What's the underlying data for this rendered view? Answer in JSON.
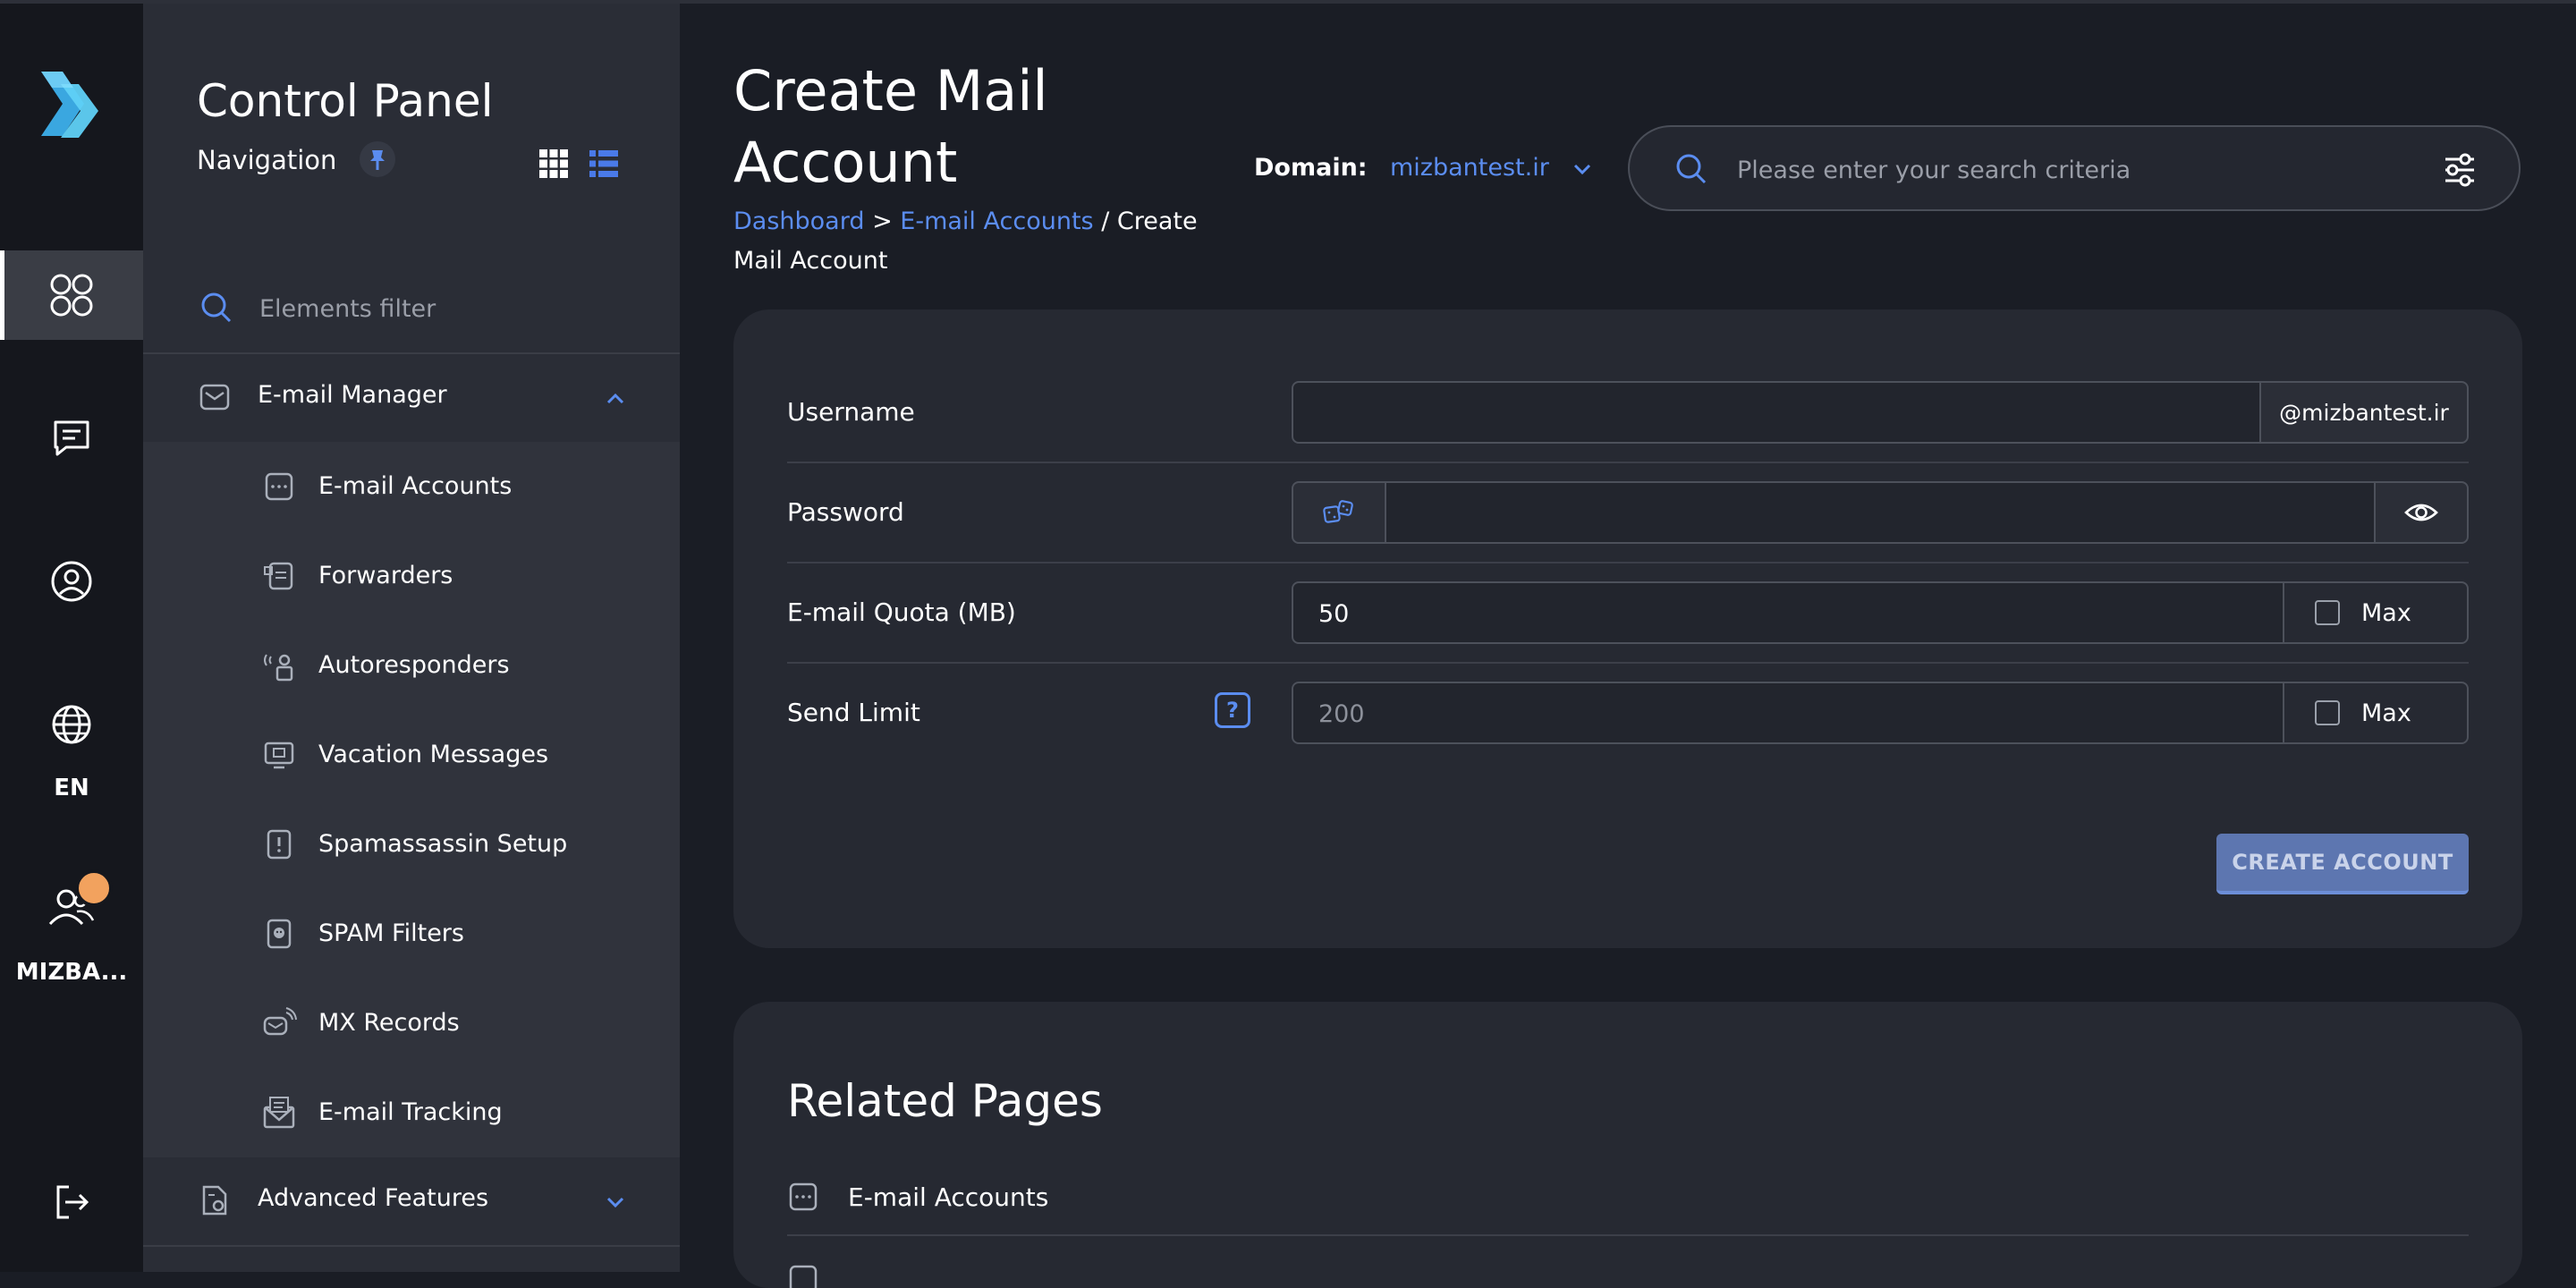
{
  "nav": {
    "title": "Control Panel",
    "subtitle": "Navigation",
    "filter_placeholder": "Elements filter",
    "groups": [
      {
        "label": "E-mail Manager",
        "expanded": true
      },
      {
        "label": "Advanced Features",
        "expanded": false
      }
    ],
    "items": [
      {
        "label": "E-mail Accounts",
        "icon": "email-accounts-icon"
      },
      {
        "label": "Forwarders",
        "icon": "forwarders-icon"
      },
      {
        "label": "Autoresponders",
        "icon": "autoresponders-icon"
      },
      {
        "label": "Vacation Messages",
        "icon": "vacation-messages-icon"
      },
      {
        "label": "Spamassassin Setup",
        "icon": "spamassassin-icon"
      },
      {
        "label": "SPAM Filters",
        "icon": "spam-filters-icon"
      },
      {
        "label": "MX Records",
        "icon": "mx-records-icon"
      },
      {
        "label": "E-mail Tracking",
        "icon": "email-tracking-icon"
      }
    ]
  },
  "rail": {
    "language": "EN",
    "user": "MIZBA..."
  },
  "header": {
    "title_line1": "Create Mail",
    "title_line2": "Account",
    "breadcrumb": {
      "dashboard": "Dashboard",
      "sep1": " > ",
      "email_accounts": "E-mail Accounts",
      "sep2": " / ",
      "current": "Create Mail Account"
    },
    "domain_label": "Domain:",
    "domain_value": "mizbantest.ir",
    "search_placeholder": "Please enter your search criteria"
  },
  "form": {
    "username_label": "Username",
    "username_value": "",
    "domain_suffix": "@mizbantest.ir",
    "password_label": "Password",
    "password_value": "",
    "quota_label": "E-mail Quota (MB)",
    "quota_value": "50",
    "quota_max_label": "Max",
    "quota_max_checked": false,
    "send_limit_label": "Send Limit",
    "send_limit_help": "?",
    "send_limit_value": "",
    "send_limit_placeholder": "200",
    "send_limit_max_label": "Max",
    "send_limit_max_checked": false,
    "submit_label": "CREATE ACCOUNT"
  },
  "related": {
    "title": "Related Pages",
    "items": [
      {
        "label": "E-mail Accounts",
        "icon": "email-accounts-icon"
      }
    ]
  },
  "colors": {
    "accent": "#5b8df0",
    "background": "#1a1d25",
    "rail": "#15171d",
    "panel": "#2a2d36",
    "card": "#262932",
    "button": "#5d76b0",
    "notification": "#f2a25e"
  }
}
